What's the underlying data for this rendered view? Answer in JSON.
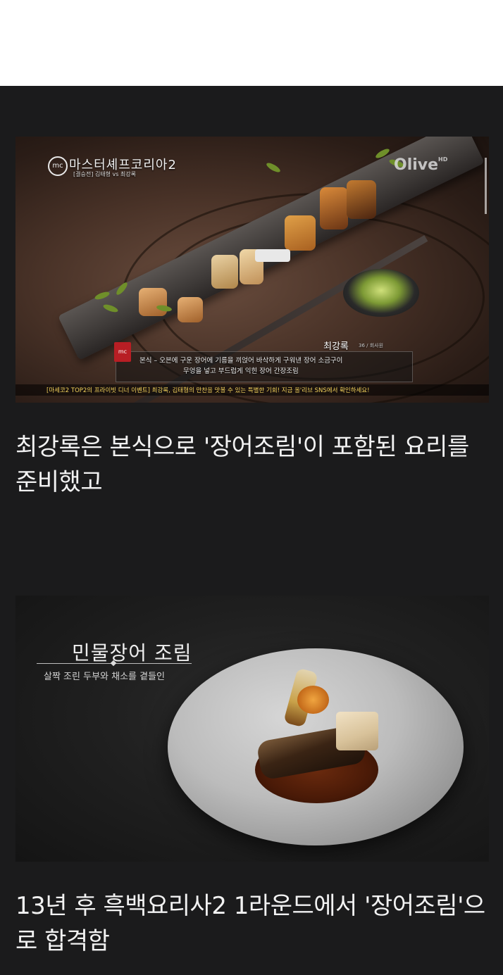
{
  "article": {
    "image1": {
      "show_logo_text": "mc",
      "show_title": "마스터셰프코리아2",
      "show_subtitle": "[결승전] 김태형 vs 최강록",
      "channel": "Olive",
      "channel_suffix": "HD",
      "chef_name": "최강록",
      "chef_meta": "36 / 회사원",
      "badge_text": "mc",
      "description_line1": "본식 – 오븐에 구운 장어에 기름을 끼얹어 바삭하게 구워낸 장어 소금구이",
      "description_line2": "무엉을 넣고 부드럽게 익힌 장어 간장조림",
      "ticker": "[마세코2 TOP2의 프라이빗 디너 이벤트] 최강록, 김태형의 만찬을 맛볼 수 있는 특별한 기회! 지금 올'리브 SNS에서 확인하세요!"
    },
    "caption1": "최강록은 본식으로 '장어조림'이 포함된 요리를 준비했고",
    "image2": {
      "dish_title": "민물장어 조림",
      "dish_subtitle": "살짝 조린 두부와 채소를 곁들인"
    },
    "caption2": "13년 후 흑백요리사2 1라운드에서 '장어조림'으로 합격함"
  },
  "colors": {
    "page_background": "#1b1b1c",
    "caption_text": "#f2f2f2",
    "ticker_text": "#f2d25c",
    "badge_red": "#b81e24"
  }
}
